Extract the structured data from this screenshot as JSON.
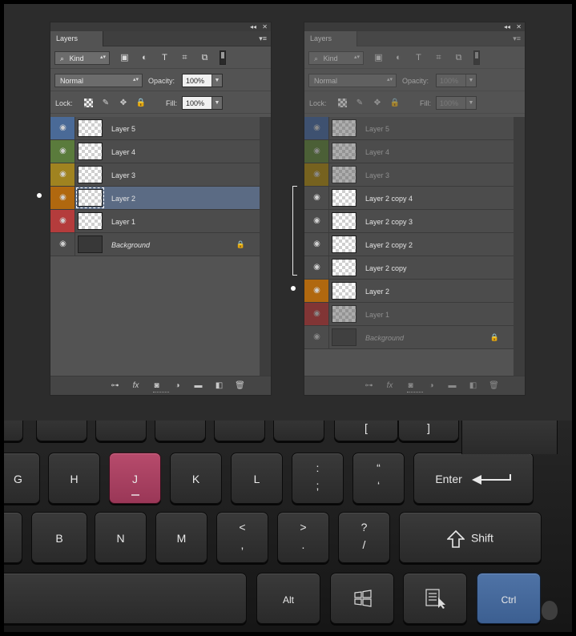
{
  "panels": {
    "left": {
      "tab_label": "Layers",
      "collapse_glyph": "◂◂",
      "close_glyph": "✕",
      "menu_glyph": "▾≡",
      "kind_label": "Kind",
      "blend_mode": "Normal",
      "opacity_label": "Opacity:",
      "opacity_value": "100%",
      "lock_label": "Lock:",
      "fill_label": "Fill:",
      "fill_value": "100%",
      "layers": [
        {
          "name": "Layer 5",
          "color": "blue"
        },
        {
          "name": "Layer 4",
          "color": "green"
        },
        {
          "name": "Layer 3",
          "color": "yellow"
        },
        {
          "name": "Layer 2",
          "color": "orange",
          "selected": true
        },
        {
          "name": "Layer 1",
          "color": "red"
        },
        {
          "name": "Background",
          "color": "none",
          "locked": true
        }
      ]
    },
    "right": {
      "tab_label": "Layers",
      "collapse_glyph": "◂◂",
      "close_glyph": "✕",
      "menu_glyph": "▾≡",
      "kind_label": "Kind",
      "blend_mode": "Normal",
      "opacity_label": "Opacity:",
      "opacity_value": "100%",
      "lock_label": "Lock:",
      "fill_label": "Fill:",
      "fill_value": "100%",
      "layers": [
        {
          "name": "Layer 5",
          "color": "blue"
        },
        {
          "name": "Layer 4",
          "color": "green"
        },
        {
          "name": "Layer 3",
          "color": "yellow"
        },
        {
          "name": "Layer 2 copy 4",
          "color": "none"
        },
        {
          "name": "Layer 2 copy 3",
          "color": "none"
        },
        {
          "name": "Layer 2 copy 2",
          "color": "none"
        },
        {
          "name": "Layer 2 copy",
          "color": "none"
        },
        {
          "name": "Layer 2",
          "color": "orange"
        },
        {
          "name": "Layer 1",
          "color": "red"
        },
        {
          "name": "Background",
          "color": "none",
          "locked": true
        }
      ]
    }
  },
  "icons": {
    "search": "⌕",
    "image_filter": "▣",
    "adjust_filter": "◐",
    "type_filter": "T",
    "shape_filter": "⌗",
    "smart_filter": "⧉",
    "brush": "✎",
    "move": "✥",
    "lock": "🔒",
    "eye": "◉",
    "link": "⊶",
    "fx": "fx",
    "mask": "◙",
    "adjustment": "◑",
    "folder": "▬",
    "new_layer": "◧",
    "trash": "🗑"
  },
  "keyboard": {
    "row1": [
      "[",
      "]"
    ],
    "row2": [
      {
        "id": "g",
        "label": "G"
      },
      {
        "id": "h",
        "label": "H"
      },
      {
        "id": "j",
        "label": "J"
      },
      {
        "id": "k",
        "label": "K"
      },
      {
        "id": "l",
        "label": "L"
      },
      {
        "id": "semicolon",
        "top": ":",
        "bottom": ";"
      },
      {
        "id": "quote",
        "top": "“",
        "bottom": "‘"
      }
    ],
    "enter": "Enter",
    "row3": [
      {
        "id": "b",
        "label": "B"
      },
      {
        "id": "n",
        "label": "N"
      },
      {
        "id": "m",
        "label": "M"
      },
      {
        "id": "comma",
        "top": "<",
        "bottom": ","
      },
      {
        "id": "period",
        "top": ">",
        "bottom": "."
      },
      {
        "id": "slash",
        "top": "?",
        "bottom": "/"
      }
    ],
    "shift": "Shift",
    "alt": "Alt",
    "ctrl": "Ctrl",
    "highlighted": [
      "J",
      "Ctrl"
    ]
  },
  "colors": {
    "label_blue": "#4a6a97",
    "label_green": "#5a7b3c",
    "label_yellow": "#a08320",
    "label_orange": "#b0680f",
    "label_red": "#b43c3c",
    "key_j": "#a84060",
    "key_ctrl": "#4568a0"
  }
}
